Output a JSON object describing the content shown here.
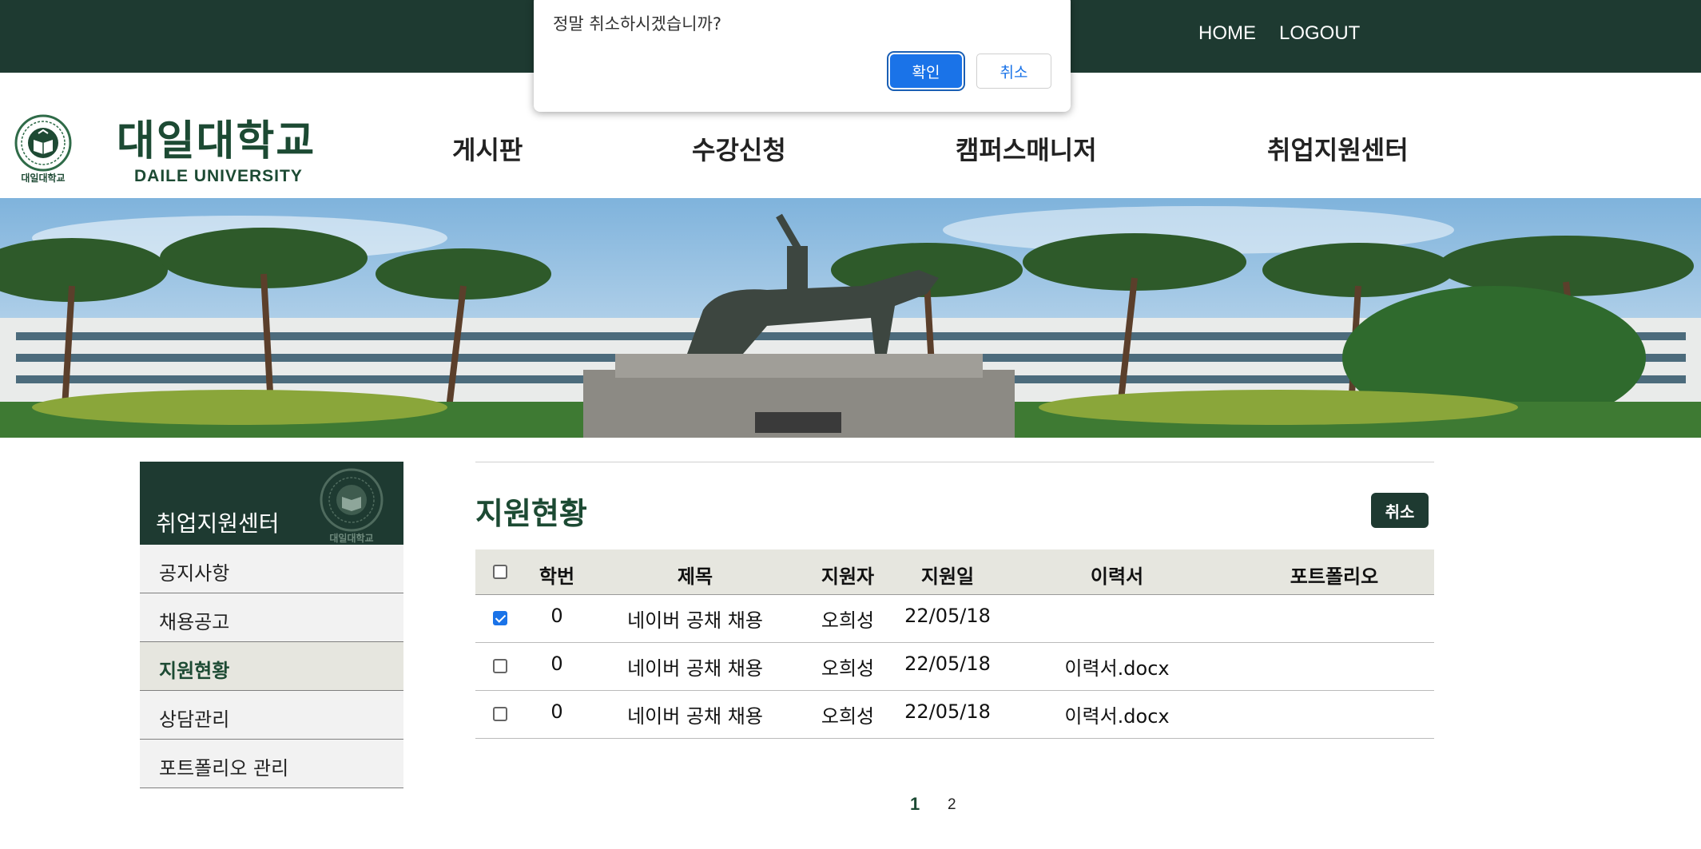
{
  "topbar": {
    "home_label": "HOME",
    "logout_label": "LOGOUT"
  },
  "header": {
    "brand_kr": "대일대학교",
    "brand_en": "DAILE UNIVERSITY",
    "emblem_text": "대일대학교",
    "nav": [
      {
        "label": "게시판"
      },
      {
        "label": "수강신청"
      },
      {
        "label": "캠퍼스매니저"
      },
      {
        "label": "취업지원센터"
      }
    ]
  },
  "sidebar": {
    "title": "취업지원센터",
    "items": [
      {
        "label": "공지사항"
      },
      {
        "label": "채용공고"
      },
      {
        "label": "지원현황",
        "active": true
      },
      {
        "label": "상담관리"
      },
      {
        "label": "포트폴리오 관리"
      }
    ]
  },
  "main": {
    "title": "지원현황",
    "cancel_label": "취소",
    "columns": [
      "학번",
      "제목",
      "지원자",
      "지원일",
      "이력서",
      "포트폴리오"
    ],
    "rows": [
      {
        "checked": true,
        "id": "0",
        "title": "네이버 공채 채용",
        "applicant": "오희성",
        "date": "22/05/18",
        "resume": "",
        "portfolio": ""
      },
      {
        "checked": false,
        "id": "0",
        "title": "네이버 공채 채용",
        "applicant": "오희성",
        "date": "22/05/18",
        "resume": "이력서.docx",
        "portfolio": ""
      },
      {
        "checked": false,
        "id": "0",
        "title": "네이버 공채 채용",
        "applicant": "오희성",
        "date": "22/05/18",
        "resume": "이력서.docx",
        "portfolio": ""
      }
    ],
    "pagination": {
      "pages": [
        "1",
        "2"
      ],
      "current": "1"
    }
  },
  "dialog": {
    "message": "정말 취소하시겠습니까?",
    "confirm_label": "확인",
    "cancel_label": "취소"
  },
  "colors": {
    "brand_dark": "#1e3a31",
    "brand_text": "#1c4a33",
    "dialog_primary": "#1a73e8"
  },
  "icons": [
    "university-emblem-icon",
    "checkbox-icon"
  ]
}
